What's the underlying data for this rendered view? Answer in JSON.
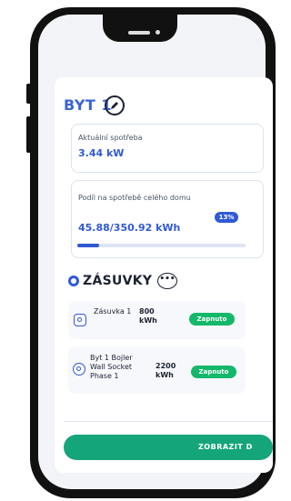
{
  "header": {
    "title": "BYT 1"
  },
  "consumption": {
    "label": "Aktuální spotřeba",
    "value": "3.44 kW"
  },
  "share": {
    "label": "Podíl na spotřebě celého domu",
    "value": "45.88/350.92 kWh",
    "percent_label": "13%",
    "fraction": 0.13
  },
  "sockets": {
    "title": "ZÁSUVKY",
    "items": [
      {
        "name": "Zásuvka 1",
        "power": "800 kWh",
        "status": "Zapnuto"
      },
      {
        "name": "Byt 1 Bojler Wall Socket Phase 1",
        "power": "2200 kWh",
        "status": "Zapnuto"
      }
    ]
  },
  "cta": {
    "label": "ZOBRAZIT D"
  },
  "colors": {
    "accent": "#2f5ad6",
    "status_on": "#14b86a",
    "cta": "#15a57a"
  }
}
